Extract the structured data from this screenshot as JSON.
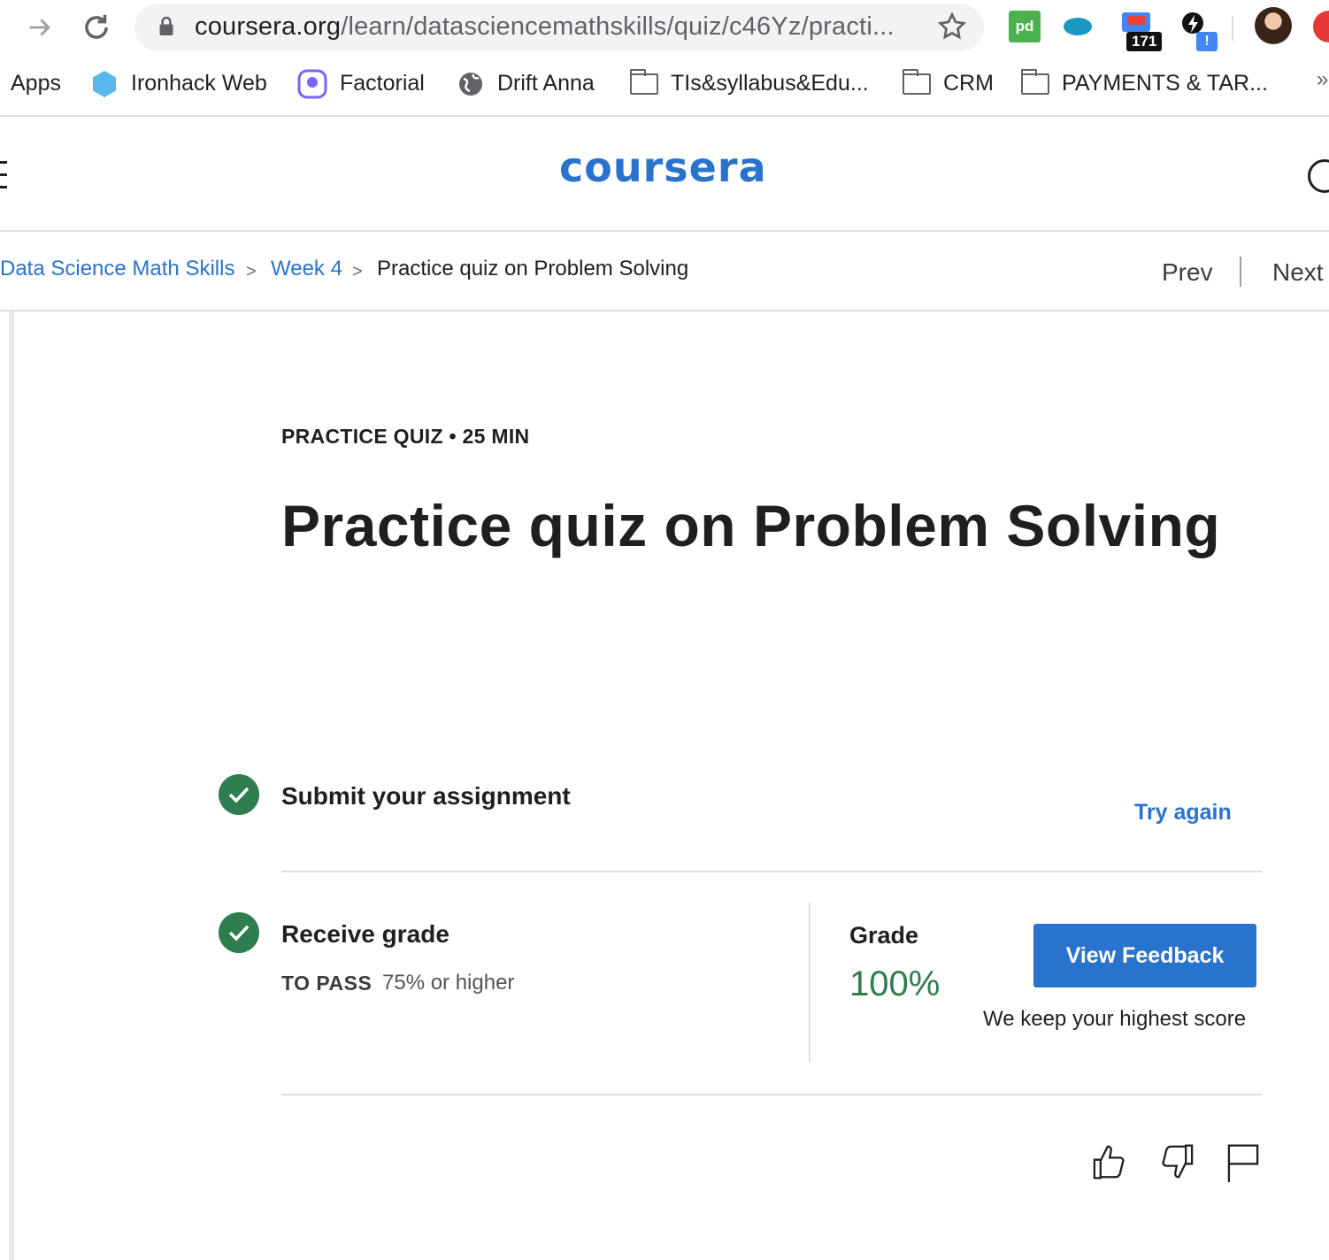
{
  "browser": {
    "url_host": "coursera.org",
    "url_path": "/learn/datasciencemathskills/quiz/c46Yz/practi...",
    "extensions": {
      "pd_label": "pd",
      "gmail_count": "171",
      "bolt_badge": "!"
    },
    "colors": {
      "omnibox": "#f1f3f4"
    }
  },
  "bookmarks": {
    "items": [
      {
        "label": "Apps",
        "icon": "apps-grid-icon"
      },
      {
        "label": "Ironhack Web",
        "icon": "ironhack-icon"
      },
      {
        "label": "Factorial",
        "icon": "factorial-icon"
      },
      {
        "label": "Drift Anna",
        "icon": "globe-icon"
      },
      {
        "label": "TIs&syllabus&Edu...",
        "icon": "folder-icon"
      },
      {
        "label": "CRM",
        "icon": "folder-icon"
      },
      {
        "label": "PAYMENTS & TAR...",
        "icon": "folder-icon"
      }
    ],
    "overflow": "»"
  },
  "header": {
    "logo": "coursera",
    "brand_color": "#2a73cc"
  },
  "breadcrumb": {
    "items": [
      "Data Science Math Skills",
      "Week 4",
      "Practice quiz on Problem Solving"
    ],
    "prev": "Prev",
    "next": "Next"
  },
  "quiz": {
    "kicker": "PRACTICE QUIZ • 25 MIN",
    "title": "Practice quiz on Problem Solving",
    "steps": [
      {
        "title": "Submit your assignment",
        "action": "Try again",
        "status": "complete"
      },
      {
        "title": "Receive grade",
        "status": "complete"
      }
    ],
    "to_pass_label": "TO PASS",
    "to_pass_value": "75% or higher",
    "grade_label": "Grade",
    "grade_value": "100%",
    "view_feedback": "View Feedback",
    "keep_note": "We keep your highest score",
    "success_color": "#2e7d4f"
  }
}
